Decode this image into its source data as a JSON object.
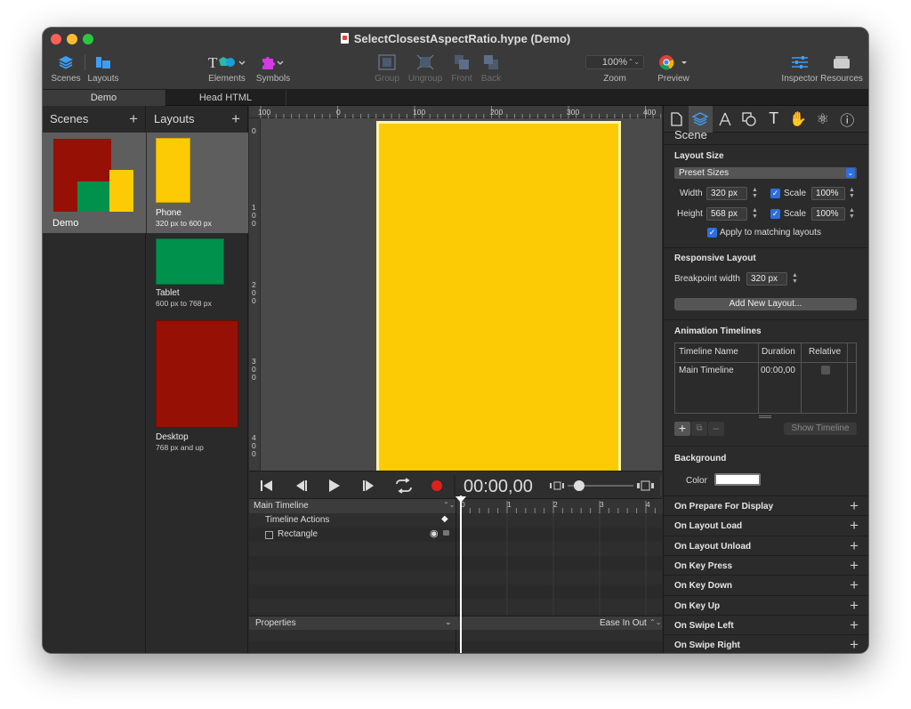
{
  "window": {
    "title": "SelectClosestAspectRatio.hype (Demo)"
  },
  "toolbar": {
    "scenes": "Scenes",
    "layouts": "Layouts",
    "elements": "Elements",
    "symbols": "Symbols",
    "group": "Group",
    "ungroup": "Ungroup",
    "front": "Front",
    "back": "Back",
    "zoom_value": "100%",
    "zoom": "Zoom",
    "preview": "Preview",
    "inspector": "Inspector",
    "resources": "Resources"
  },
  "tabs": [
    "Demo",
    "Head HTML"
  ],
  "scenes_panel": {
    "title": "Scenes",
    "plus": "+",
    "scene_name": "Demo"
  },
  "layouts_panel": {
    "title": "Layouts",
    "plus": "+",
    "items": [
      {
        "name": "Phone",
        "range": "320 px to 600 px",
        "color": "#fccb05"
      },
      {
        "name": "Tablet",
        "range": "600 px to 768 px",
        "color": "#00914d"
      },
      {
        "name": "Desktop",
        "range": "768 px and up",
        "color": "#961006"
      }
    ]
  },
  "canvas": {
    "ruler_top": [
      "100",
      "0",
      "100",
      "200",
      "300",
      "400"
    ],
    "ruler_left": [
      "0",
      "1\n0\n0",
      "2\n0\n0",
      "3\n0\n0",
      "4\n0\n0"
    ],
    "scene_color": "#fccb05"
  },
  "transport": {
    "time": "00:00,00"
  },
  "timeline": {
    "name": "Main Timeline",
    "actions": "Timeline Actions",
    "element": "Rectangle",
    "ruler": [
      "0",
      "1",
      "2",
      "3",
      "4"
    ],
    "properties": "Properties",
    "easing": "Ease In Out"
  },
  "inspector": {
    "scene_title": "Scene",
    "layout_size": "Layout Size",
    "preset": "Preset Sizes",
    "width_label": "Width",
    "width_value": "320 px",
    "height_label": "Height",
    "height_value": "568 px",
    "scale_label": "Scale",
    "scale_value": "100%",
    "apply_label": "Apply to matching layouts",
    "responsive": "Responsive Layout",
    "breakpoint_label": "Breakpoint width",
    "breakpoint_value": "320 px",
    "add_layout": "Add New Layout...",
    "animation_timelines": "Animation Timelines",
    "col_name": "Timeline Name",
    "col_duration": "Duration",
    "col_relative": "Relative",
    "row_name": "Main Timeline",
    "row_duration": "00:00,00",
    "show_timeline": "Show Timeline",
    "background": "Background",
    "color_label": "Color",
    "events": [
      "On Prepare For Display",
      "On Layout Load",
      "On Layout Unload",
      "On Key Press",
      "On Key Down",
      "On Key Up",
      "On Swipe Left",
      "On Swipe Right"
    ]
  },
  "colors": {
    "accent": "#2d6ee0",
    "record": "#e0201c",
    "yellow": "#fccb05",
    "green": "#00914d",
    "red": "#961006"
  }
}
